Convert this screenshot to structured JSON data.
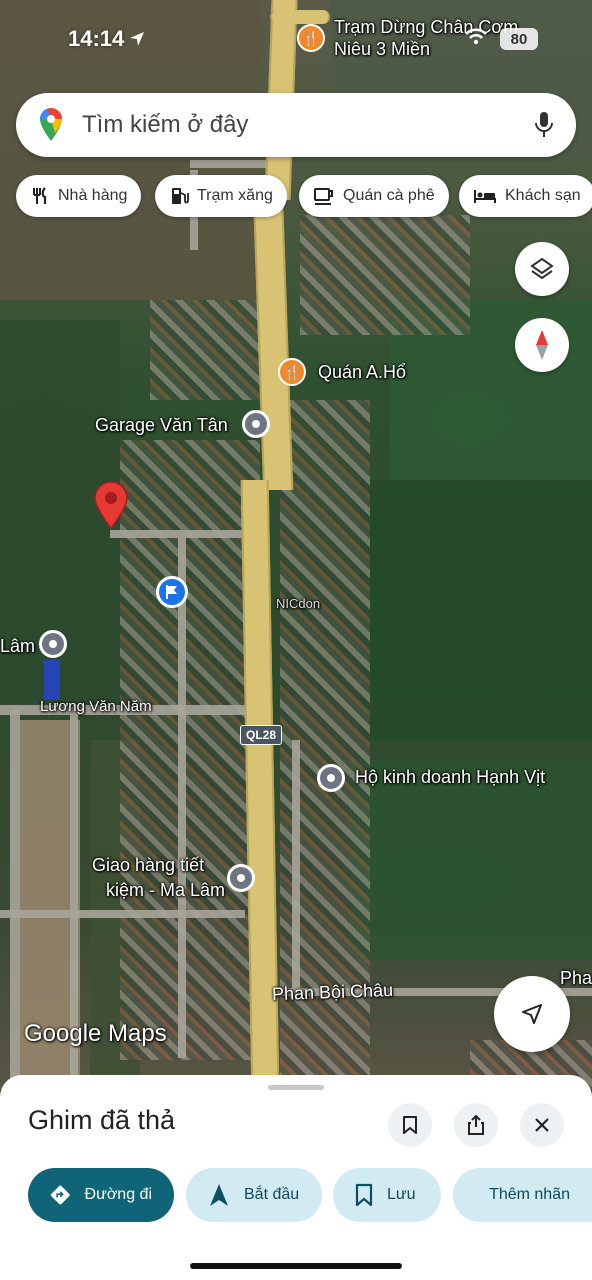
{
  "status_bar": {
    "time": "14:14",
    "battery": "80"
  },
  "search": {
    "placeholder": "Tìm kiếm ở đây"
  },
  "chips": [
    {
      "label": "Nhà hàng",
      "icon": "fork-knife-icon"
    },
    {
      "label": "Trạm xăng",
      "icon": "gas-station-icon"
    },
    {
      "label": "Quán cà phê",
      "icon": "coffee-cup-icon"
    },
    {
      "label": "Khách sạn",
      "icon": "bed-icon"
    }
  ],
  "map": {
    "labels": {
      "tram_dung_chan": "Trạm Dừng Chân Cơm Niêu 3 Miền",
      "quan_a_ho": "Quán A.Hổ",
      "garage": "Garage Văn Tân",
      "lam": "Lâm",
      "luong_van_nam": "Lương Văn Năm",
      "route": "QL28",
      "ho_kinh_doanh": "Hộ kinh doanh Hạnh Vịt",
      "giao_hang_1": "Giao hàng tiết",
      "giao_hang_2": "kiệm - Ma Lâm",
      "phan_boi_chau": "Phan Bội Châu",
      "pha": "Pha",
      "shop_sign": "NICdon"
    },
    "watermark": "Google Maps"
  },
  "sheet": {
    "title": "Ghim đã thả",
    "actions": [
      {
        "label": "Đường đi",
        "icon": "directions-icon"
      },
      {
        "label": "Bắt đầu",
        "icon": "navigation-arrow-icon"
      },
      {
        "label": "Lưu",
        "icon": "bookmark-icon"
      },
      {
        "label": "Thêm nhãn",
        "icon": "flag-icon"
      }
    ]
  },
  "colors": {
    "accent": "#0f6577",
    "chip_bg": "#d2ebf3",
    "pin_red": "#e53935",
    "food_pin": "#ef8a2c",
    "poi_gray": "#6d7680",
    "highway": "#d8c274"
  }
}
